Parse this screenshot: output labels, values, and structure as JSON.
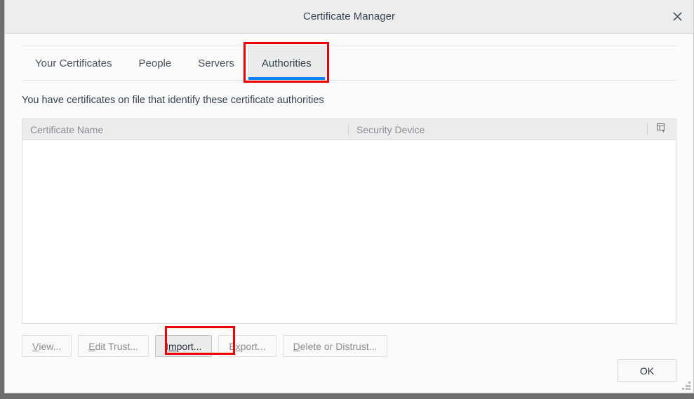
{
  "window": {
    "title": "Certificate Manager",
    "close_icon": "close-icon",
    "close_label": "✕"
  },
  "tabs": [
    {
      "label": "Your Certificates",
      "selected": false
    },
    {
      "label": "People",
      "selected": false
    },
    {
      "label": "Servers",
      "selected": false
    },
    {
      "label": "Authorities",
      "selected": true
    }
  ],
  "description": "You have certificates on file that identify these certificate authorities",
  "table": {
    "columns": [
      {
        "label": "Certificate Name"
      },
      {
        "label": "Security Device"
      }
    ],
    "column_picker_icon": "column-picker-icon",
    "rows": []
  },
  "actions": [
    {
      "id": "view",
      "pre": "",
      "accesskey": "V",
      "post": "iew...",
      "enabled": false
    },
    {
      "id": "edit-trust",
      "pre": "",
      "accesskey": "E",
      "post": "dit Trust...",
      "enabled": false
    },
    {
      "id": "import",
      "pre": "I",
      "accesskey": "m",
      "post": "port...",
      "enabled": true
    },
    {
      "id": "export",
      "pre": "E",
      "accesskey": "x",
      "post": "port...",
      "enabled": false
    },
    {
      "id": "delete-or-distrust",
      "pre": "",
      "accesskey": "D",
      "post": "elete or Distrust...",
      "enabled": false
    }
  ],
  "footer": {
    "ok_label": "OK"
  },
  "annotations": [
    {
      "target": "tab-authorities",
      "color": "#ee0000"
    },
    {
      "target": "import-button",
      "color": "#ee0000"
    }
  ],
  "colors": {
    "accent_blue": "#0a84ff",
    "highlight_red": "#ee0000",
    "titlebar_bg": "#ededed",
    "dialog_bg": "#fbfbfb",
    "table_header_bg": "#ececec",
    "backdrop": "#6e6e6e"
  }
}
